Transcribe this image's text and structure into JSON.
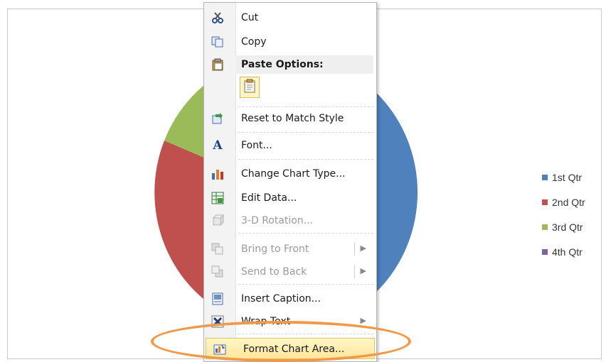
{
  "legend": {
    "items": [
      {
        "label": "1st Qtr",
        "color": "#4f81bd"
      },
      {
        "label": "2nd Qtr",
        "color": "#c0504d"
      },
      {
        "label": "3rd Qtr",
        "color": "#9bbb59"
      },
      {
        "label": "4th Qtr",
        "color": "#8064a2"
      }
    ]
  },
  "context_menu": {
    "cut": "Cut",
    "copy": "Copy",
    "paste_options": "Paste Options:",
    "reset_to_match_style": "Reset to Match Style",
    "font": "Font...",
    "change_chart_type": "Change Chart Type...",
    "edit_data": "Edit Data...",
    "rotation_3d": "3-D Rotation...",
    "bring_to_front": "Bring to Front",
    "send_to_back": "Send to Back",
    "insert_caption": "Insert Caption...",
    "wrap_text": "Wrap Text",
    "format_chart_area": "Format Chart Area..."
  },
  "icons": {
    "cut": "scissors-icon",
    "copy": "copy-icon",
    "paste_options": "clipboard-icon",
    "paste_keep": "paste-keep-formatting-icon",
    "reset": "reset-style-icon",
    "font": "font-icon",
    "change_chart_type": "bar-chart-icon",
    "edit_data": "spreadsheet-icon",
    "rotation_3d": "rotation-icon",
    "bring_to_front": "bring-front-icon",
    "send_to_back": "send-back-icon",
    "insert_caption": "caption-icon",
    "wrap_text": "wrap-text-icon",
    "format_chart_area": "format-area-icon"
  },
  "highlight_color": "#ef9a4a"
}
